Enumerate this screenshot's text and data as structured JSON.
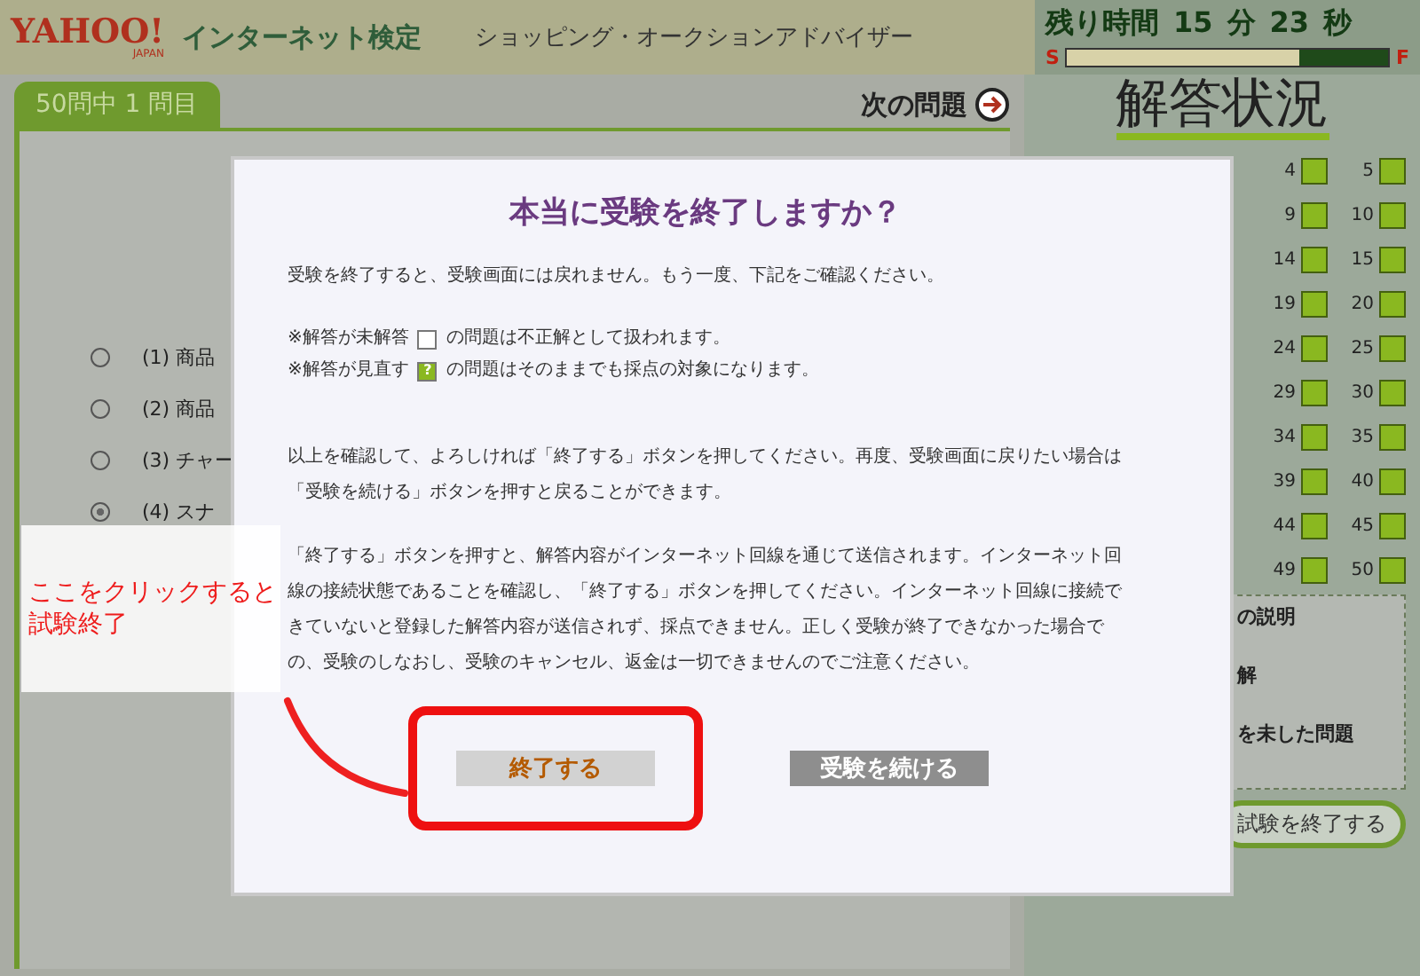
{
  "header": {
    "logo": "YAHOO!",
    "logo_sub": "JAPAN",
    "product": "インターネット検定",
    "exam": "ショッピング・オークションアドバイザー"
  },
  "timer": {
    "label": "残り時間",
    "minutes": "15",
    "min_unit": "分",
    "seconds": "23",
    "sec_unit": "秒",
    "start": "S",
    "end": "F",
    "level": 0.72
  },
  "question_panel": {
    "tab": "50問中 1 問目",
    "next": "次の問題",
    "options": [
      {
        "label": "(1) 商品",
        "selected": false
      },
      {
        "label": "(2) 商品",
        "selected": false
      },
      {
        "label": "(3) チャー",
        "selected": false
      },
      {
        "label": "(4) スナ",
        "selected": true
      }
    ]
  },
  "status_panel": {
    "title": "解答状況",
    "cells": [
      "4",
      "5",
      "9",
      "10",
      "14",
      "15",
      "19",
      "20",
      "24",
      "25",
      "29",
      "30",
      "34",
      "35",
      "39",
      "40",
      "44",
      "45",
      "49",
      "50"
    ],
    "legend_title": "の説明",
    "legend_lines": [
      "解",
      "を未した問題"
    ],
    "finish_button": "試験を終了する"
  },
  "dialog": {
    "title": "本当に受験を終了しますか？",
    "intro": "受験を終了すると、受験画面には戻れません。もう一度、下記をご確認ください。",
    "notes": [
      {
        "before": "※解答が未解答",
        "kind": "empty",
        "after": "の問題は不正解として扱われます。"
      },
      {
        "before": "※解答が見直す",
        "kind": "review",
        "mark": "?",
        "after": "の問題はそのままでも採点の対象になります。"
      }
    ],
    "paragraphs": [
      "以上を確認して、よろしければ「終了する」ボタンを押してください。再度、受験画面に戻りたい場合は「受験を続ける」ボタンを押すと戻ることができます。",
      "「終了する」ボタンを押すと、解答内容がインターネット回線を通じて送信されます。インターネット回線の接続状態であることを確認し、「終了する」ボタンを押してください。インターネット回線に接続できていないと登録した解答内容が送信されず、採点できません。正しく受験が終了できなかった場合での、受験のしなおし、受験のキャンセル、返金は一切できませんのでご注意ください。"
    ],
    "buttons": [
      {
        "label": "終了する",
        "disabled": false
      },
      {
        "label": "受験を続ける",
        "disabled": true
      }
    ]
  },
  "annotation": {
    "lines": [
      "ここをクリックすると",
      "試験終了"
    ]
  }
}
